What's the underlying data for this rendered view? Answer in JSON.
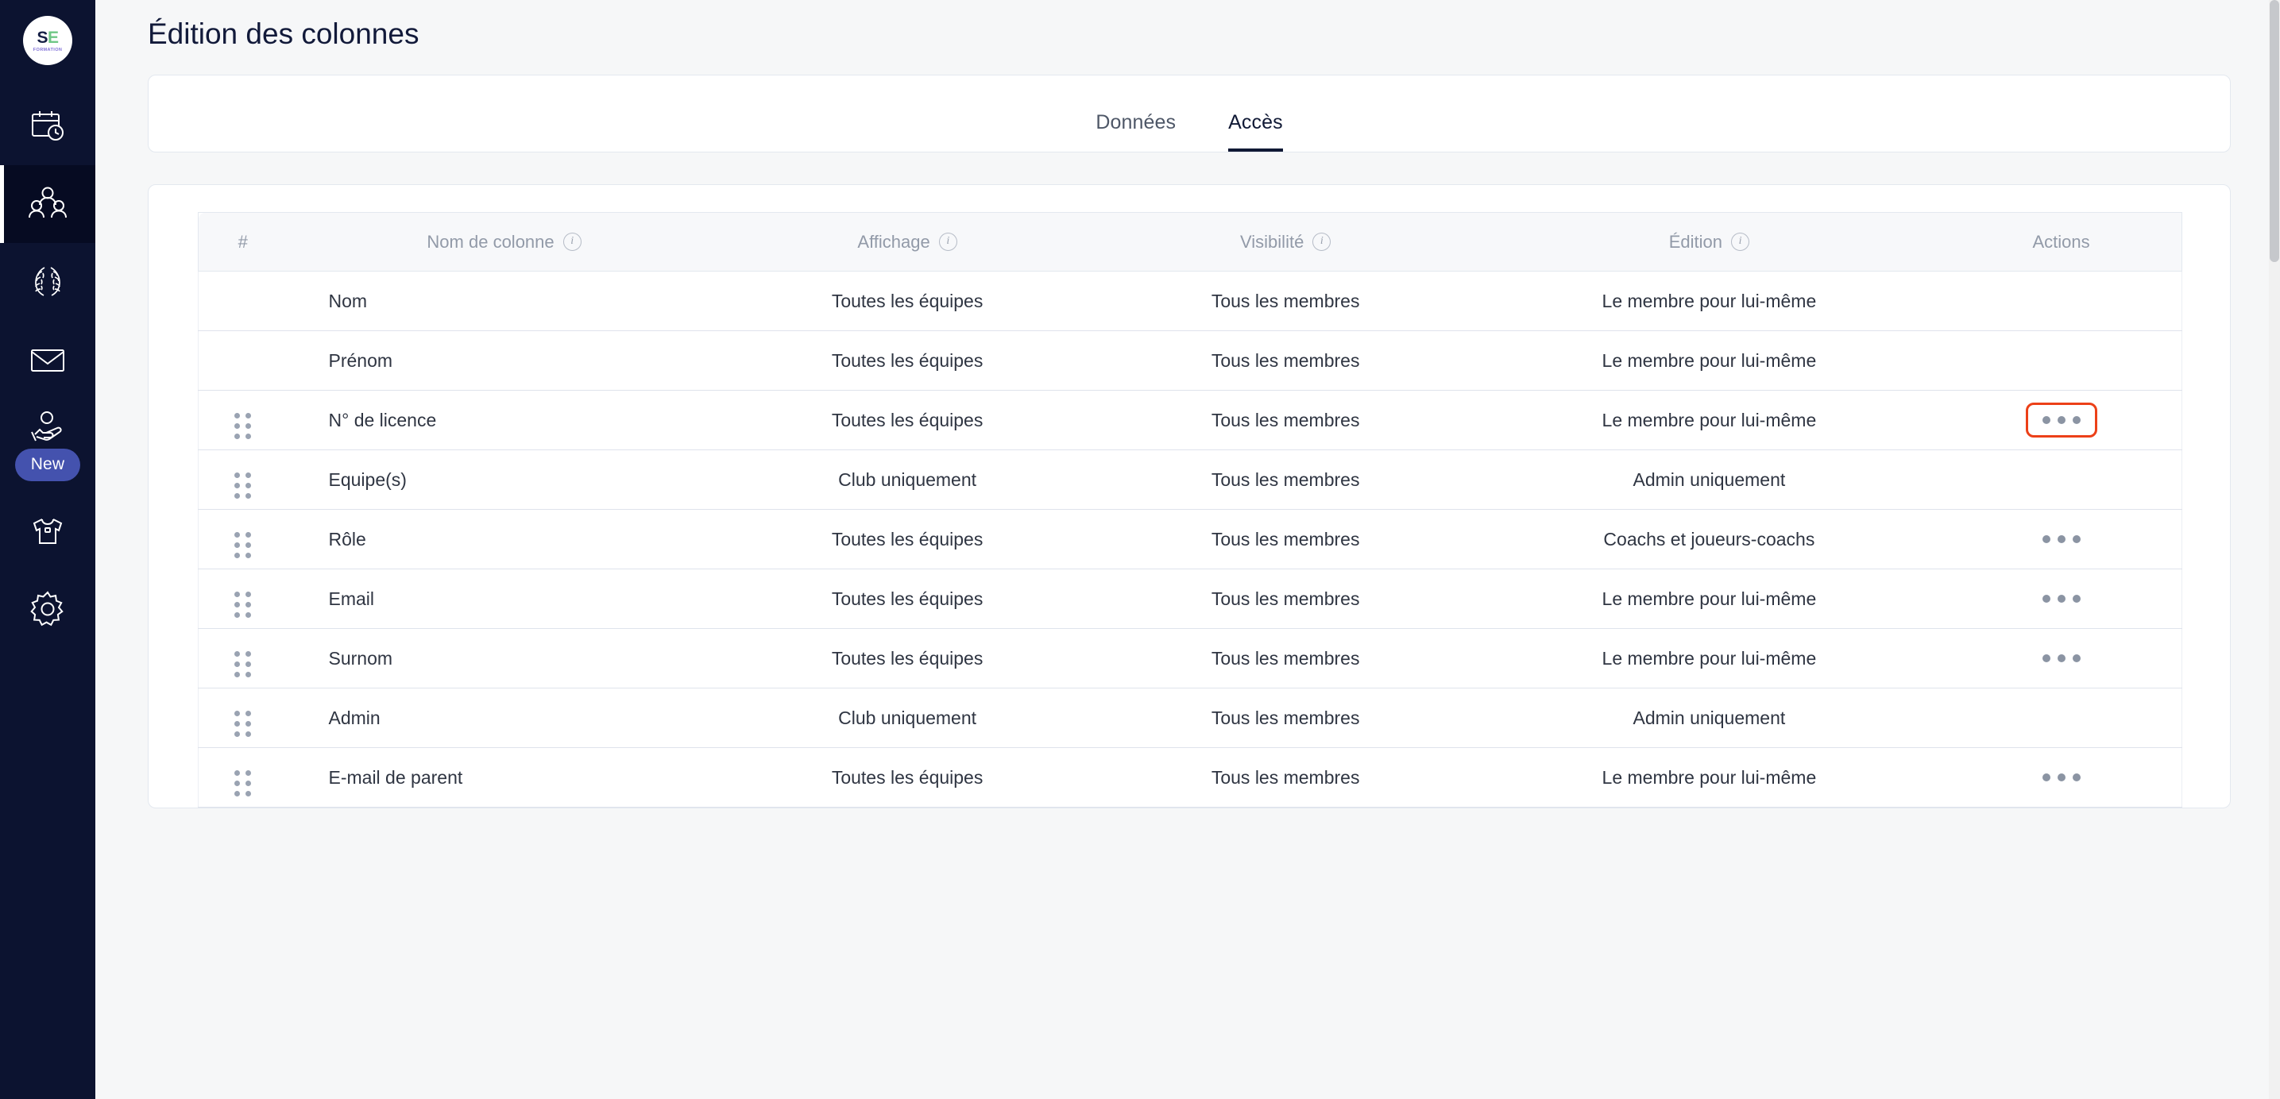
{
  "brand": {
    "logo_primary": "S",
    "logo_secondary": "E",
    "logo_subtitle": "FORMATION",
    "logo_color_dark": "#151f45",
    "logo_color_green": "#6fc785"
  },
  "sidebar": {
    "background": "#0c1330",
    "active_indicator_color": "#ffffff",
    "items": [
      {
        "icon": "calendar-clock-icon",
        "active": false
      },
      {
        "icon": "people-group-icon",
        "active": true
      },
      {
        "icon": "laurel-wreath-icon",
        "active": false
      },
      {
        "icon": "envelope-icon",
        "active": false
      },
      {
        "icon": "hand-coin-icon",
        "active": false,
        "badge": "New",
        "badge_color": "#4452ae"
      },
      {
        "icon": "tshirt-icon",
        "active": false
      },
      {
        "icon": "gear-icon",
        "active": false
      }
    ]
  },
  "header": {
    "title": "Édition des colonnes"
  },
  "tabs": [
    {
      "label": "Données",
      "active": false
    },
    {
      "label": "Accès",
      "active": true
    }
  ],
  "table": {
    "headers": [
      {
        "label": "#",
        "info": false
      },
      {
        "label": "Nom de colonne",
        "info": true
      },
      {
        "label": "Affichage",
        "info": true
      },
      {
        "label": "Visibilité",
        "info": true
      },
      {
        "label": "Édition",
        "info": true
      },
      {
        "label": "Actions",
        "info": false
      }
    ],
    "info_icon": "i",
    "rows": [
      {
        "handle": false,
        "name": "Nom",
        "affichage": "Toutes les équipes",
        "visibilite": "Tous les membres",
        "edition": "Le membre pour lui-même",
        "actions": false,
        "highlight": false
      },
      {
        "handle": false,
        "name": "Prénom",
        "affichage": "Toutes les équipes",
        "visibilite": "Tous les membres",
        "edition": "Le membre pour lui-même",
        "actions": false,
        "highlight": false
      },
      {
        "handle": true,
        "name": "N° de licence",
        "affichage": "Toutes les équipes",
        "visibilite": "Tous les membres",
        "edition": "Le membre pour lui-même",
        "actions": true,
        "highlight": true
      },
      {
        "handle": true,
        "name": "Equipe(s)",
        "affichage": "Club uniquement",
        "visibilite": "Tous les membres",
        "edition": "Admin uniquement",
        "actions": false,
        "highlight": false
      },
      {
        "handle": true,
        "name": "Rôle",
        "affichage": "Toutes les équipes",
        "visibilite": "Tous les membres",
        "edition": "Coachs et joueurs-coachs",
        "actions": true,
        "highlight": false
      },
      {
        "handle": true,
        "name": "Email",
        "affichage": "Toutes les équipes",
        "visibilite": "Tous les membres",
        "edition": "Le membre pour lui-même",
        "actions": true,
        "highlight": false
      },
      {
        "handle": true,
        "name": "Surnom",
        "affichage": "Toutes les équipes",
        "visibilite": "Tous les membres",
        "edition": "Le membre pour lui-même",
        "actions": true,
        "highlight": false
      },
      {
        "handle": true,
        "name": "Admin",
        "affichage": "Club uniquement",
        "visibilite": "Tous les membres",
        "edition": "Admin uniquement",
        "actions": false,
        "highlight": false
      },
      {
        "handle": true,
        "name": "E-mail de parent",
        "affichage": "Toutes les équipes",
        "visibilite": "Tous les membres",
        "edition": "Le membre pour lui-même",
        "actions": true,
        "highlight": false
      }
    ]
  },
  "highlight": {
    "color": "#ec4018"
  }
}
